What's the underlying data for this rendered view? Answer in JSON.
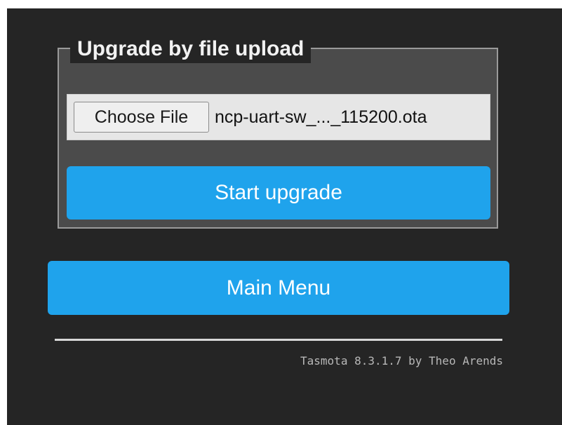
{
  "upload": {
    "legend": "Upgrade by file upload",
    "choose_file_label": "Choose File",
    "selected_file_name": "ncp-uart-sw_..._115200.ota",
    "start_button_label": "Start upgrade"
  },
  "navigation": {
    "main_menu_label": "Main Menu"
  },
  "footer": {
    "version_text": "Tasmota 8.3.1.7 by Theo Arends"
  },
  "colors": {
    "page_background": "#252525",
    "fieldset_background": "#4b4b4b",
    "button_accent": "#1fa3ec",
    "button_text": "#ffffff"
  }
}
